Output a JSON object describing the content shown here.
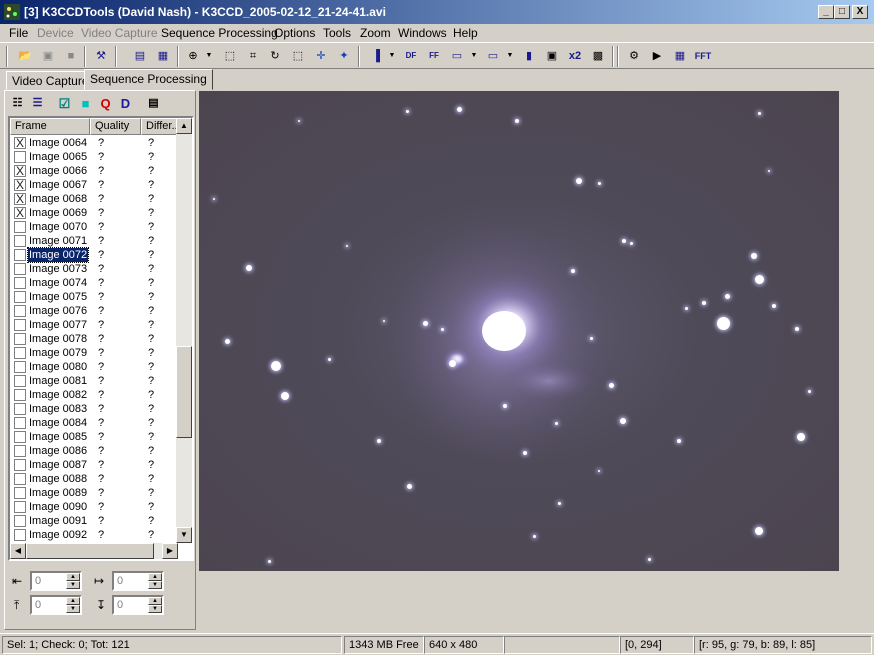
{
  "window": {
    "title": "[3] K3CCDTools (David Nash) - K3CCD_2005-02-12_21-24-41.avi",
    "min_label": "_",
    "max_label": "□",
    "close_label": "X"
  },
  "menu": {
    "file": "File",
    "device": "Device",
    "video_capture": "Video Capture",
    "sequence_processing": "Sequence Processing",
    "options": "Options",
    "tools": "Tools",
    "zoom": "Zoom",
    "windows": "Windows",
    "help": "Help"
  },
  "toolbar": {
    "x2": "x2",
    "fft": "FFT",
    "df": "DF",
    "ff": "FF"
  },
  "tabs": {
    "video_capture": "Video Capture",
    "sequence_processing": "Sequence Processing"
  },
  "panel_tools": {
    "q": "Q",
    "d": "D"
  },
  "list": {
    "headers": [
      "Frame",
      "Quality",
      "Differ..."
    ],
    "rows": [
      {
        "name": "Image 0064",
        "checked": "X",
        "q": "?",
        "d": "?"
      },
      {
        "name": "Image 0065",
        "checked": "",
        "q": "?",
        "d": "?"
      },
      {
        "name": "Image 0066",
        "checked": "X",
        "q": "?",
        "d": "?"
      },
      {
        "name": "Image 0067",
        "checked": "X",
        "q": "?",
        "d": "?"
      },
      {
        "name": "Image 0068",
        "checked": "X",
        "q": "?",
        "d": "?"
      },
      {
        "name": "Image 0069",
        "checked": "X",
        "q": "?",
        "d": "?"
      },
      {
        "name": "Image 0070",
        "checked": "",
        "q": "?",
        "d": "?"
      },
      {
        "name": "Image 0071",
        "checked": "",
        "q": "?",
        "d": "?"
      },
      {
        "name": "Image 0072",
        "checked": "",
        "q": "?",
        "d": "?"
      },
      {
        "name": "Image 0073",
        "checked": "",
        "q": "?",
        "d": "?"
      },
      {
        "name": "Image 0074",
        "checked": "",
        "q": "?",
        "d": "?"
      },
      {
        "name": "Image 0075",
        "checked": "",
        "q": "?",
        "d": "?"
      },
      {
        "name": "Image 0076",
        "checked": "",
        "q": "?",
        "d": "?"
      },
      {
        "name": "Image 0077",
        "checked": "",
        "q": "?",
        "d": "?"
      },
      {
        "name": "Image 0078",
        "checked": "",
        "q": "?",
        "d": "?"
      },
      {
        "name": "Image 0079",
        "checked": "",
        "q": "?",
        "d": "?"
      },
      {
        "name": "Image 0080",
        "checked": "",
        "q": "?",
        "d": "?"
      },
      {
        "name": "Image 0081",
        "checked": "",
        "q": "?",
        "d": "?"
      },
      {
        "name": "Image 0082",
        "checked": "",
        "q": "?",
        "d": "?"
      },
      {
        "name": "Image 0083",
        "checked": "",
        "q": "?",
        "d": "?"
      },
      {
        "name": "Image 0084",
        "checked": "",
        "q": "?",
        "d": "?"
      },
      {
        "name": "Image 0085",
        "checked": "",
        "q": "?",
        "d": "?"
      },
      {
        "name": "Image 0086",
        "checked": "",
        "q": "?",
        "d": "?"
      },
      {
        "name": "Image 0087",
        "checked": "",
        "q": "?",
        "d": "?"
      },
      {
        "name": "Image 0088",
        "checked": "",
        "q": "?",
        "d": "?"
      },
      {
        "name": "Image 0089",
        "checked": "",
        "q": "?",
        "d": "?"
      },
      {
        "name": "Image 0090",
        "checked": "",
        "q": "?",
        "d": "?"
      },
      {
        "name": "Image 0091",
        "checked": "",
        "q": "?",
        "d": "?"
      },
      {
        "name": "Image 0092",
        "checked": "",
        "q": "?",
        "d": "?"
      }
    ],
    "selected_row": "Image 0072"
  },
  "spinners": {
    "left": "0",
    "width": "0",
    "top": "0",
    "height": "0"
  },
  "status": {
    "selection": "Sel: 1; Check: 0; Tot: 121",
    "memory": "1343 MB Free",
    "resolution": "640 x 480",
    "coords": "[0, 294]",
    "pixel": "[r: 95, g: 79, b: 89, l: 85]"
  },
  "colors": {
    "titlebar_start": "#0a246a",
    "titlebar_end": "#a6caf0",
    "face": "#d4d0c8",
    "sky": "#4f4a58"
  }
}
